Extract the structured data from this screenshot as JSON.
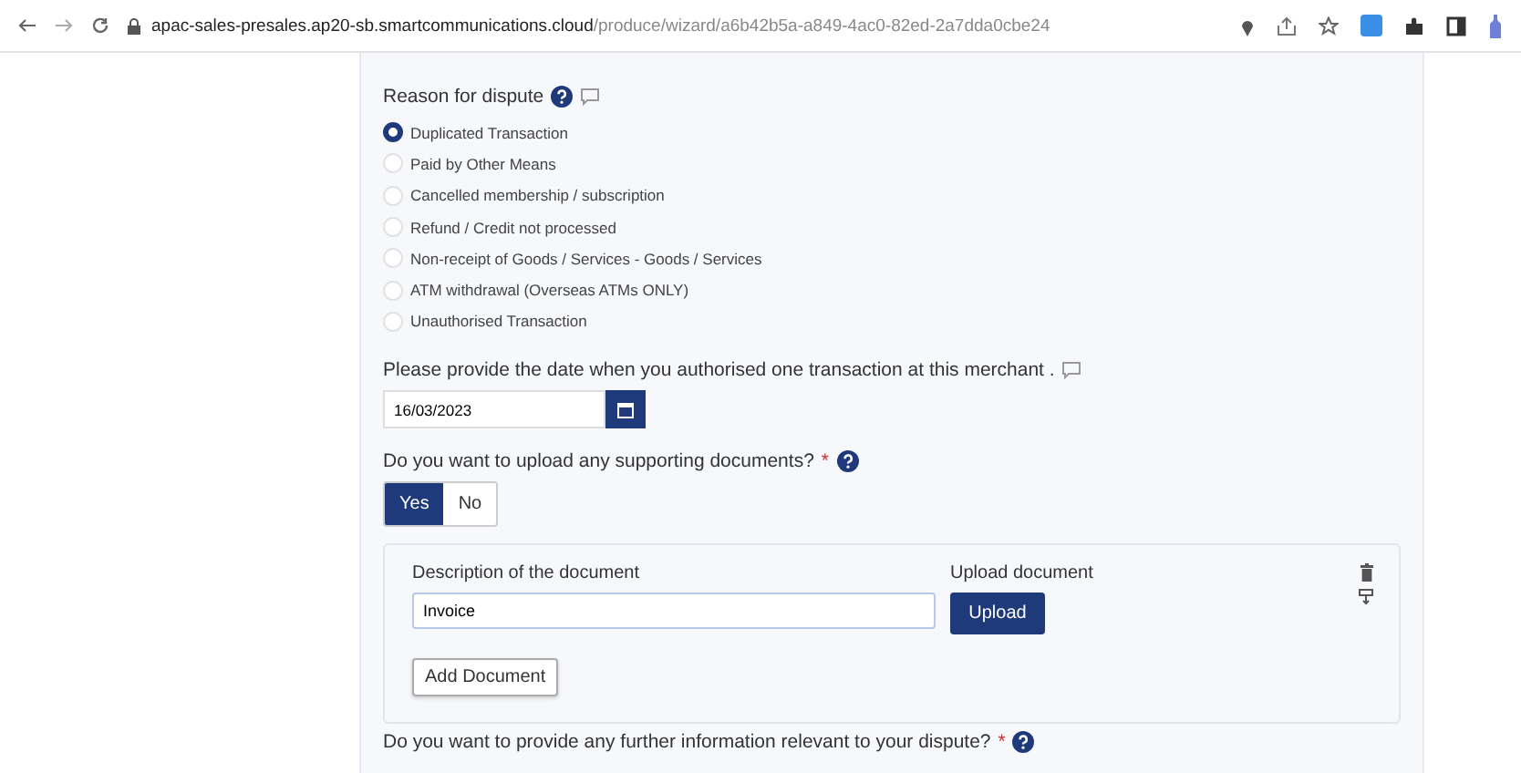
{
  "browser": {
    "url_host": "apac-sales-presales.ap20-sb.smartcommunications.cloud",
    "url_path": "/produce/wizard/a6b42b5a-a849-4ac0-82ed-2a7dda0cbe24"
  },
  "reason": {
    "label": "Reason for dispute",
    "options": [
      {
        "label": "Duplicated Transaction",
        "selected": true
      },
      {
        "label": "Paid by Other Means",
        "selected": false
      },
      {
        "label": "Cancelled membership / subscription",
        "selected": false
      },
      {
        "label": "Refund / Credit not processed",
        "selected": false
      },
      {
        "label": "Non-receipt of Goods / Services - Goods / Services",
        "selected": false
      },
      {
        "label": "ATM withdrawal (Overseas ATMs ONLY)",
        "selected": false
      },
      {
        "label": "Unauthorised Transaction",
        "selected": false
      }
    ]
  },
  "date": {
    "label": "Please provide the date when you authorised one transaction at this merchant .",
    "value": "16/03/2023"
  },
  "upload_question": {
    "label": "Do you want to upload any supporting documents?",
    "required_mark": "*",
    "choices": [
      {
        "label": "Yes",
        "selected": true
      },
      {
        "label": "No",
        "selected": false
      }
    ]
  },
  "document": {
    "description_label": "Description of the document",
    "description_value": "Invoice",
    "upload_label": "Upload document",
    "upload_button": "Upload",
    "add_button": "Add Document"
  },
  "next_question": {
    "label": "Do you want to provide any further information relevant to your dispute?",
    "required_mark": "*"
  }
}
